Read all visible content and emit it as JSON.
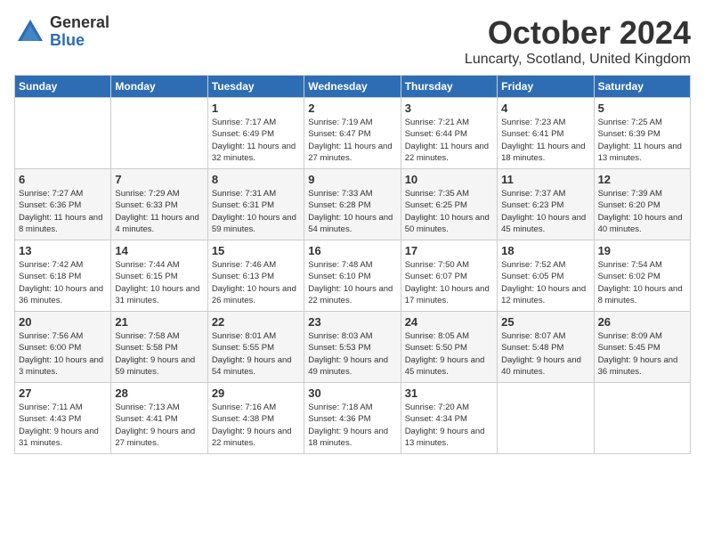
{
  "header": {
    "logo_general": "General",
    "logo_blue": "Blue",
    "month": "October 2024",
    "location": "Luncarty, Scotland, United Kingdom"
  },
  "days_of_week": [
    "Sunday",
    "Monday",
    "Tuesday",
    "Wednesday",
    "Thursday",
    "Friday",
    "Saturday"
  ],
  "weeks": [
    [
      {
        "day": "",
        "info": ""
      },
      {
        "day": "",
        "info": ""
      },
      {
        "day": "1",
        "info": "Sunrise: 7:17 AM\nSunset: 6:49 PM\nDaylight: 11 hours and 32 minutes."
      },
      {
        "day": "2",
        "info": "Sunrise: 7:19 AM\nSunset: 6:47 PM\nDaylight: 11 hours and 27 minutes."
      },
      {
        "day": "3",
        "info": "Sunrise: 7:21 AM\nSunset: 6:44 PM\nDaylight: 11 hours and 22 minutes."
      },
      {
        "day": "4",
        "info": "Sunrise: 7:23 AM\nSunset: 6:41 PM\nDaylight: 11 hours and 18 minutes."
      },
      {
        "day": "5",
        "info": "Sunrise: 7:25 AM\nSunset: 6:39 PM\nDaylight: 11 hours and 13 minutes."
      }
    ],
    [
      {
        "day": "6",
        "info": "Sunrise: 7:27 AM\nSunset: 6:36 PM\nDaylight: 11 hours and 8 minutes."
      },
      {
        "day": "7",
        "info": "Sunrise: 7:29 AM\nSunset: 6:33 PM\nDaylight: 11 hours and 4 minutes."
      },
      {
        "day": "8",
        "info": "Sunrise: 7:31 AM\nSunset: 6:31 PM\nDaylight: 10 hours and 59 minutes."
      },
      {
        "day": "9",
        "info": "Sunrise: 7:33 AM\nSunset: 6:28 PM\nDaylight: 10 hours and 54 minutes."
      },
      {
        "day": "10",
        "info": "Sunrise: 7:35 AM\nSunset: 6:25 PM\nDaylight: 10 hours and 50 minutes."
      },
      {
        "day": "11",
        "info": "Sunrise: 7:37 AM\nSunset: 6:23 PM\nDaylight: 10 hours and 45 minutes."
      },
      {
        "day": "12",
        "info": "Sunrise: 7:39 AM\nSunset: 6:20 PM\nDaylight: 10 hours and 40 minutes."
      }
    ],
    [
      {
        "day": "13",
        "info": "Sunrise: 7:42 AM\nSunset: 6:18 PM\nDaylight: 10 hours and 36 minutes."
      },
      {
        "day": "14",
        "info": "Sunrise: 7:44 AM\nSunset: 6:15 PM\nDaylight: 10 hours and 31 minutes."
      },
      {
        "day": "15",
        "info": "Sunrise: 7:46 AM\nSunset: 6:13 PM\nDaylight: 10 hours and 26 minutes."
      },
      {
        "day": "16",
        "info": "Sunrise: 7:48 AM\nSunset: 6:10 PM\nDaylight: 10 hours and 22 minutes."
      },
      {
        "day": "17",
        "info": "Sunrise: 7:50 AM\nSunset: 6:07 PM\nDaylight: 10 hours and 17 minutes."
      },
      {
        "day": "18",
        "info": "Sunrise: 7:52 AM\nSunset: 6:05 PM\nDaylight: 10 hours and 12 minutes."
      },
      {
        "day": "19",
        "info": "Sunrise: 7:54 AM\nSunset: 6:02 PM\nDaylight: 10 hours and 8 minutes."
      }
    ],
    [
      {
        "day": "20",
        "info": "Sunrise: 7:56 AM\nSunset: 6:00 PM\nDaylight: 10 hours and 3 minutes."
      },
      {
        "day": "21",
        "info": "Sunrise: 7:58 AM\nSunset: 5:58 PM\nDaylight: 9 hours and 59 minutes."
      },
      {
        "day": "22",
        "info": "Sunrise: 8:01 AM\nSunset: 5:55 PM\nDaylight: 9 hours and 54 minutes."
      },
      {
        "day": "23",
        "info": "Sunrise: 8:03 AM\nSunset: 5:53 PM\nDaylight: 9 hours and 49 minutes."
      },
      {
        "day": "24",
        "info": "Sunrise: 8:05 AM\nSunset: 5:50 PM\nDaylight: 9 hours and 45 minutes."
      },
      {
        "day": "25",
        "info": "Sunrise: 8:07 AM\nSunset: 5:48 PM\nDaylight: 9 hours and 40 minutes."
      },
      {
        "day": "26",
        "info": "Sunrise: 8:09 AM\nSunset: 5:45 PM\nDaylight: 9 hours and 36 minutes."
      }
    ],
    [
      {
        "day": "27",
        "info": "Sunrise: 7:11 AM\nSunset: 4:43 PM\nDaylight: 9 hours and 31 minutes."
      },
      {
        "day": "28",
        "info": "Sunrise: 7:13 AM\nSunset: 4:41 PM\nDaylight: 9 hours and 27 minutes."
      },
      {
        "day": "29",
        "info": "Sunrise: 7:16 AM\nSunset: 4:38 PM\nDaylight: 9 hours and 22 minutes."
      },
      {
        "day": "30",
        "info": "Sunrise: 7:18 AM\nSunset: 4:36 PM\nDaylight: 9 hours and 18 minutes."
      },
      {
        "day": "31",
        "info": "Sunrise: 7:20 AM\nSunset: 4:34 PM\nDaylight: 9 hours and 13 minutes."
      },
      {
        "day": "",
        "info": ""
      },
      {
        "day": "",
        "info": ""
      }
    ]
  ]
}
